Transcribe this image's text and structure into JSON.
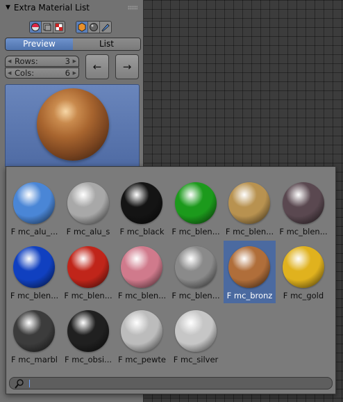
{
  "panel": {
    "title": "Extra Material List",
    "icons_group1": [
      "material-sphere-icon",
      "texture-icon",
      "checker-icon"
    ],
    "icons_group2": [
      "cube-icon",
      "sphere-icon",
      "brush-icon"
    ],
    "tabs": {
      "preview": "Preview",
      "list": "List",
      "selected": "Preview"
    },
    "rows": {
      "label": "Rows:",
      "value": "3"
    },
    "cols": {
      "label": "Cols:",
      "value": "6"
    },
    "nav": {
      "prev_glyph": "←",
      "next_glyph": "→"
    },
    "selected_material": "F mc_bronz"
  },
  "popup": {
    "materials": [
      {
        "label": "F mc_alu_...",
        "color": "#4a86d6"
      },
      {
        "label": "F mc_alu_s",
        "color": "#a8a8a8"
      },
      {
        "label": "F mc_black",
        "color": "#141414"
      },
      {
        "label": "F mc_blen...",
        "color": "#1c9a1c"
      },
      {
        "label": "F mc_blen...",
        "color": "#b89250"
      },
      {
        "label": "F mc_blen...",
        "color": "#5a4850"
      },
      {
        "label": "F mc_blen...",
        "color": "#1040c0"
      },
      {
        "label": "F mc_blen...",
        "color": "#c0251a"
      },
      {
        "label": "F mc_blen...",
        "color": "#d07a8c"
      },
      {
        "label": "F mc_blen...",
        "color": "#8a8a8a"
      },
      {
        "label": "F mc_bronz",
        "color": "#b06e3a"
      },
      {
        "label": "F mc_gold",
        "color": "#e0b21e"
      },
      {
        "label": "F mc_marbl",
        "color": "#3c3c3c"
      },
      {
        "label": "F mc_obsi...",
        "color": "#202020"
      },
      {
        "label": "F mc_pewte",
        "color": "#bcbcbc"
      },
      {
        "label": "F mc_silver",
        "color": "#c6c6c6"
      }
    ],
    "selected_index": 10,
    "search": {
      "value": ""
    }
  }
}
